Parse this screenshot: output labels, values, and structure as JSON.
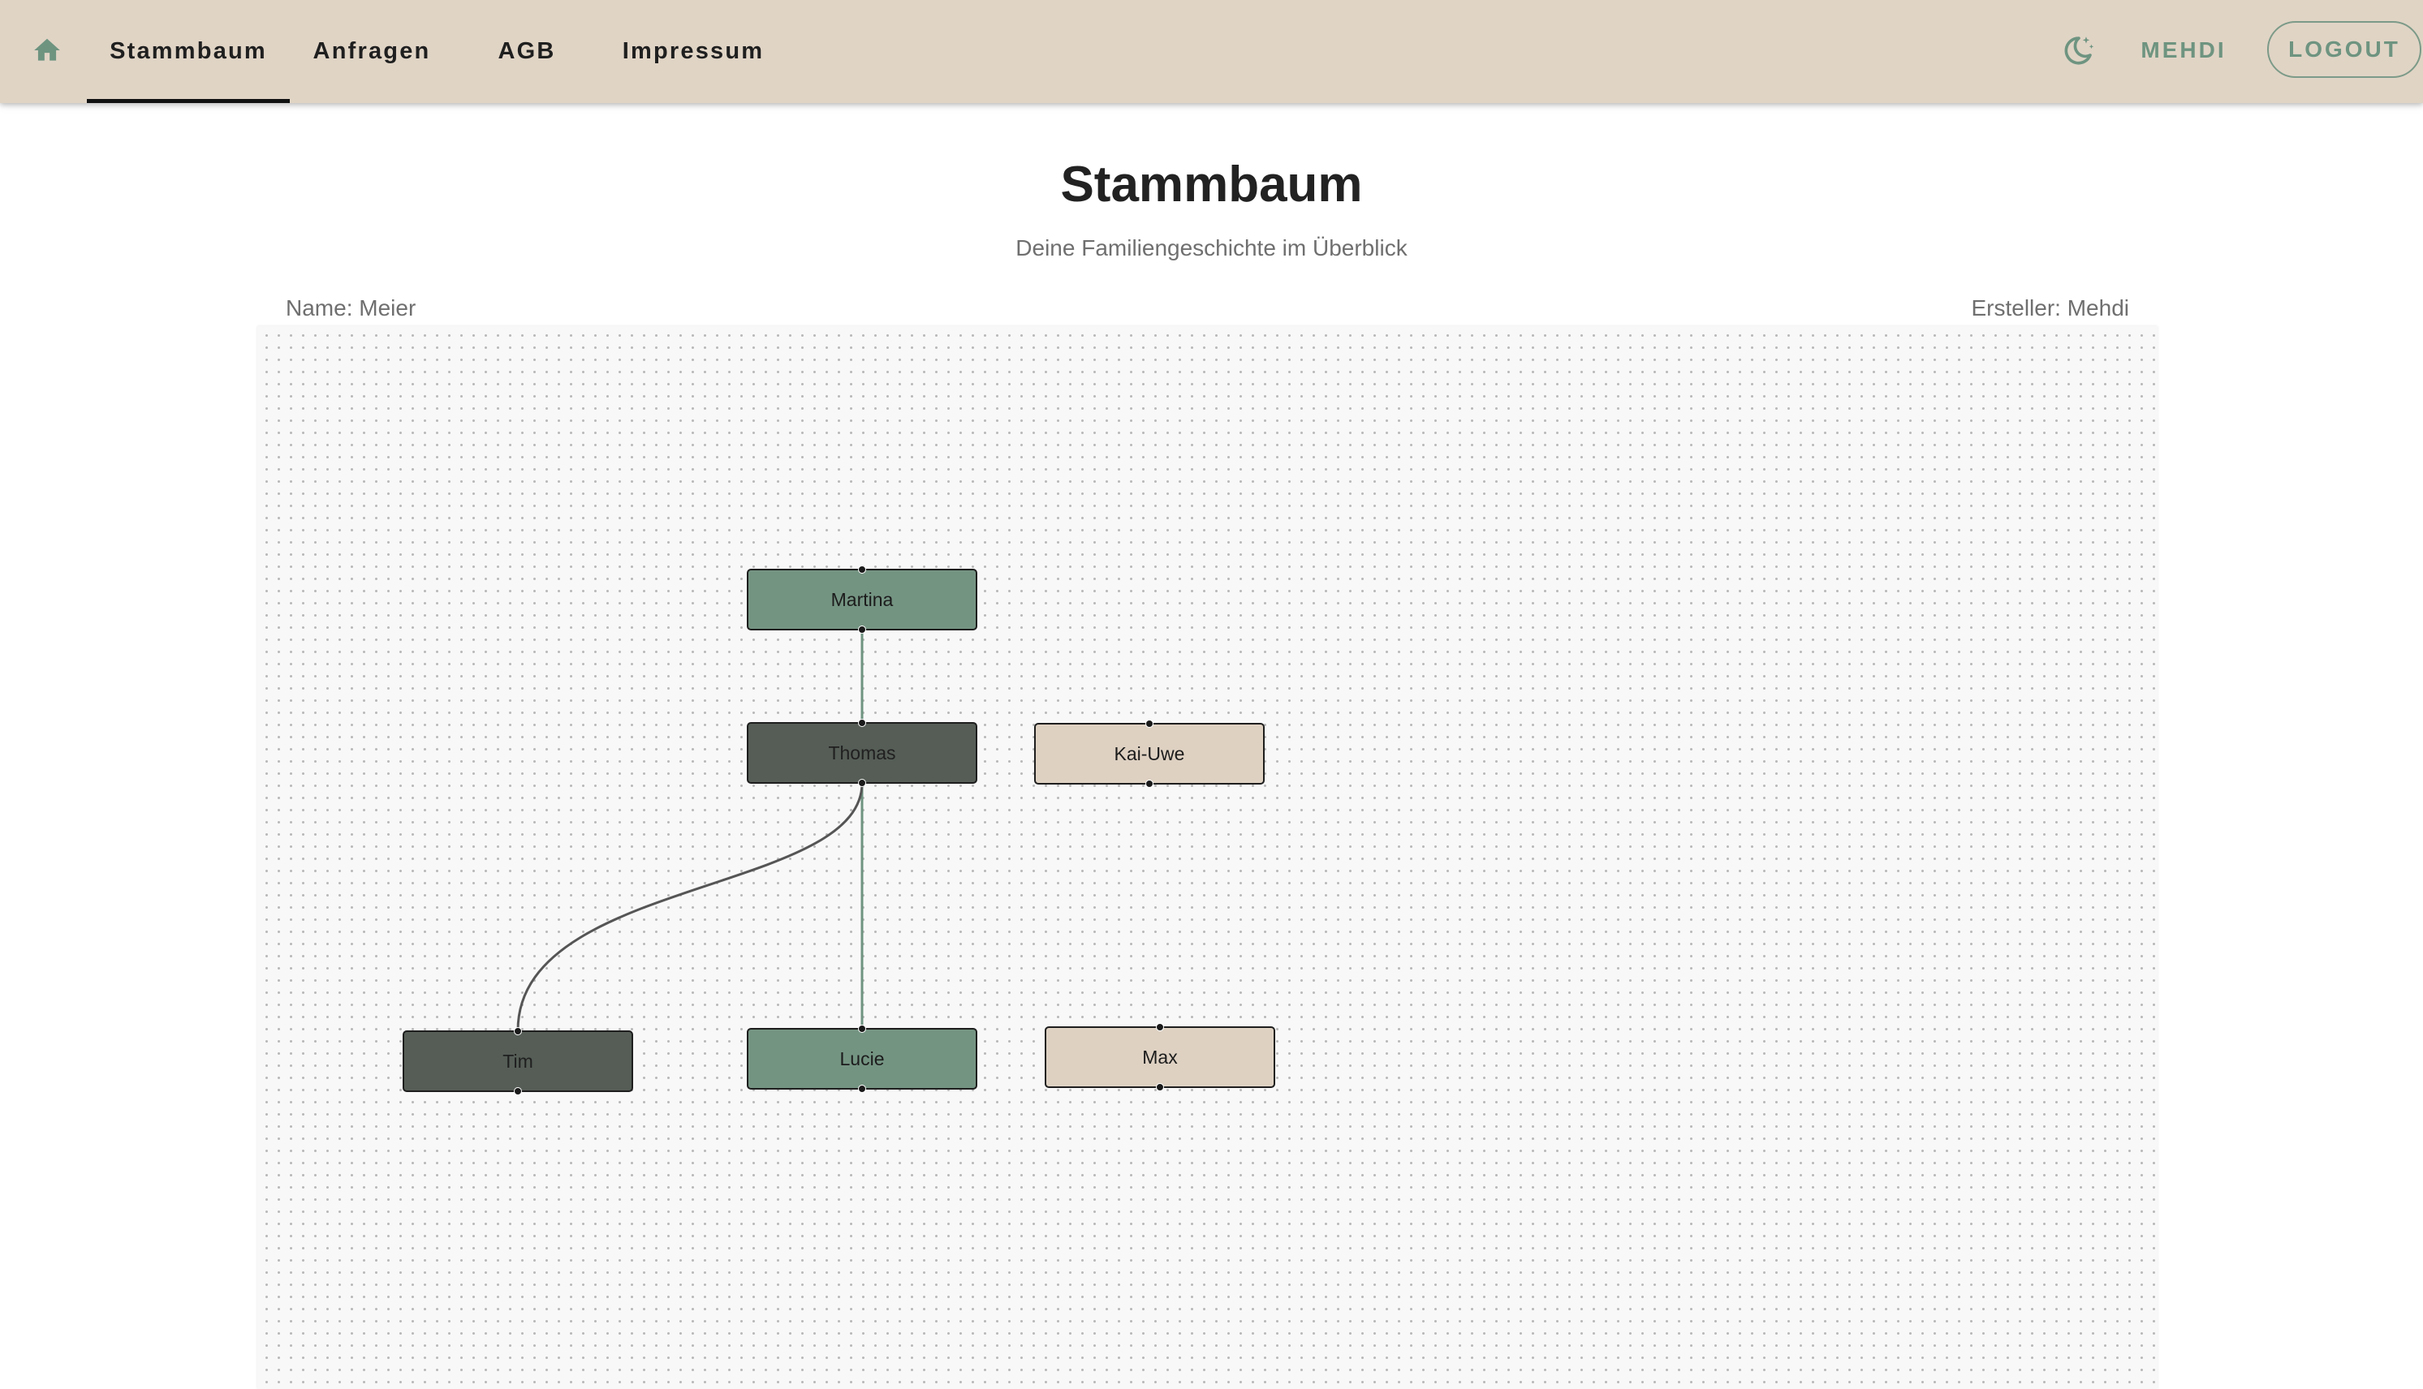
{
  "nav": {
    "home_icon": "home-icon",
    "tabs": [
      {
        "label": "Stammbaum",
        "active": true
      },
      {
        "label": "Anfragen",
        "active": false
      },
      {
        "label": "AGB",
        "active": false
      },
      {
        "label": "Impressum",
        "active": false
      }
    ],
    "theme_icon": "moon-stars-icon",
    "user_label": "MEHDI",
    "logout_label": "LOGOUT"
  },
  "page": {
    "title": "Stammbaum",
    "subtitle": "Deine Familiengeschichte im Überblick",
    "name_label": "Name: Meier",
    "creator_label": "Ersteller: Mehdi"
  },
  "tree": {
    "nodes": [
      {
        "id": "martina",
        "label": "Martina"
      },
      {
        "id": "thomas",
        "label": "Thomas"
      },
      {
        "id": "kai-uwe",
        "label": "Kai-Uwe"
      },
      {
        "id": "tim",
        "label": "Tim"
      },
      {
        "id": "lucie",
        "label": "Lucie"
      },
      {
        "id": "max",
        "label": "Max"
      }
    ],
    "edges": [
      {
        "from": "martina",
        "to": "thomas"
      },
      {
        "from": "thomas",
        "to": "lucie"
      },
      {
        "from": "thomas",
        "to": "tim"
      }
    ]
  },
  "colors": {
    "appbar": "#e0d4c5",
    "accent_green": "#749482",
    "node_dark": "#555d56",
    "node_beige": "#ded1c2",
    "edge_green": "#6e9480",
    "edge_dark": "#555555"
  }
}
